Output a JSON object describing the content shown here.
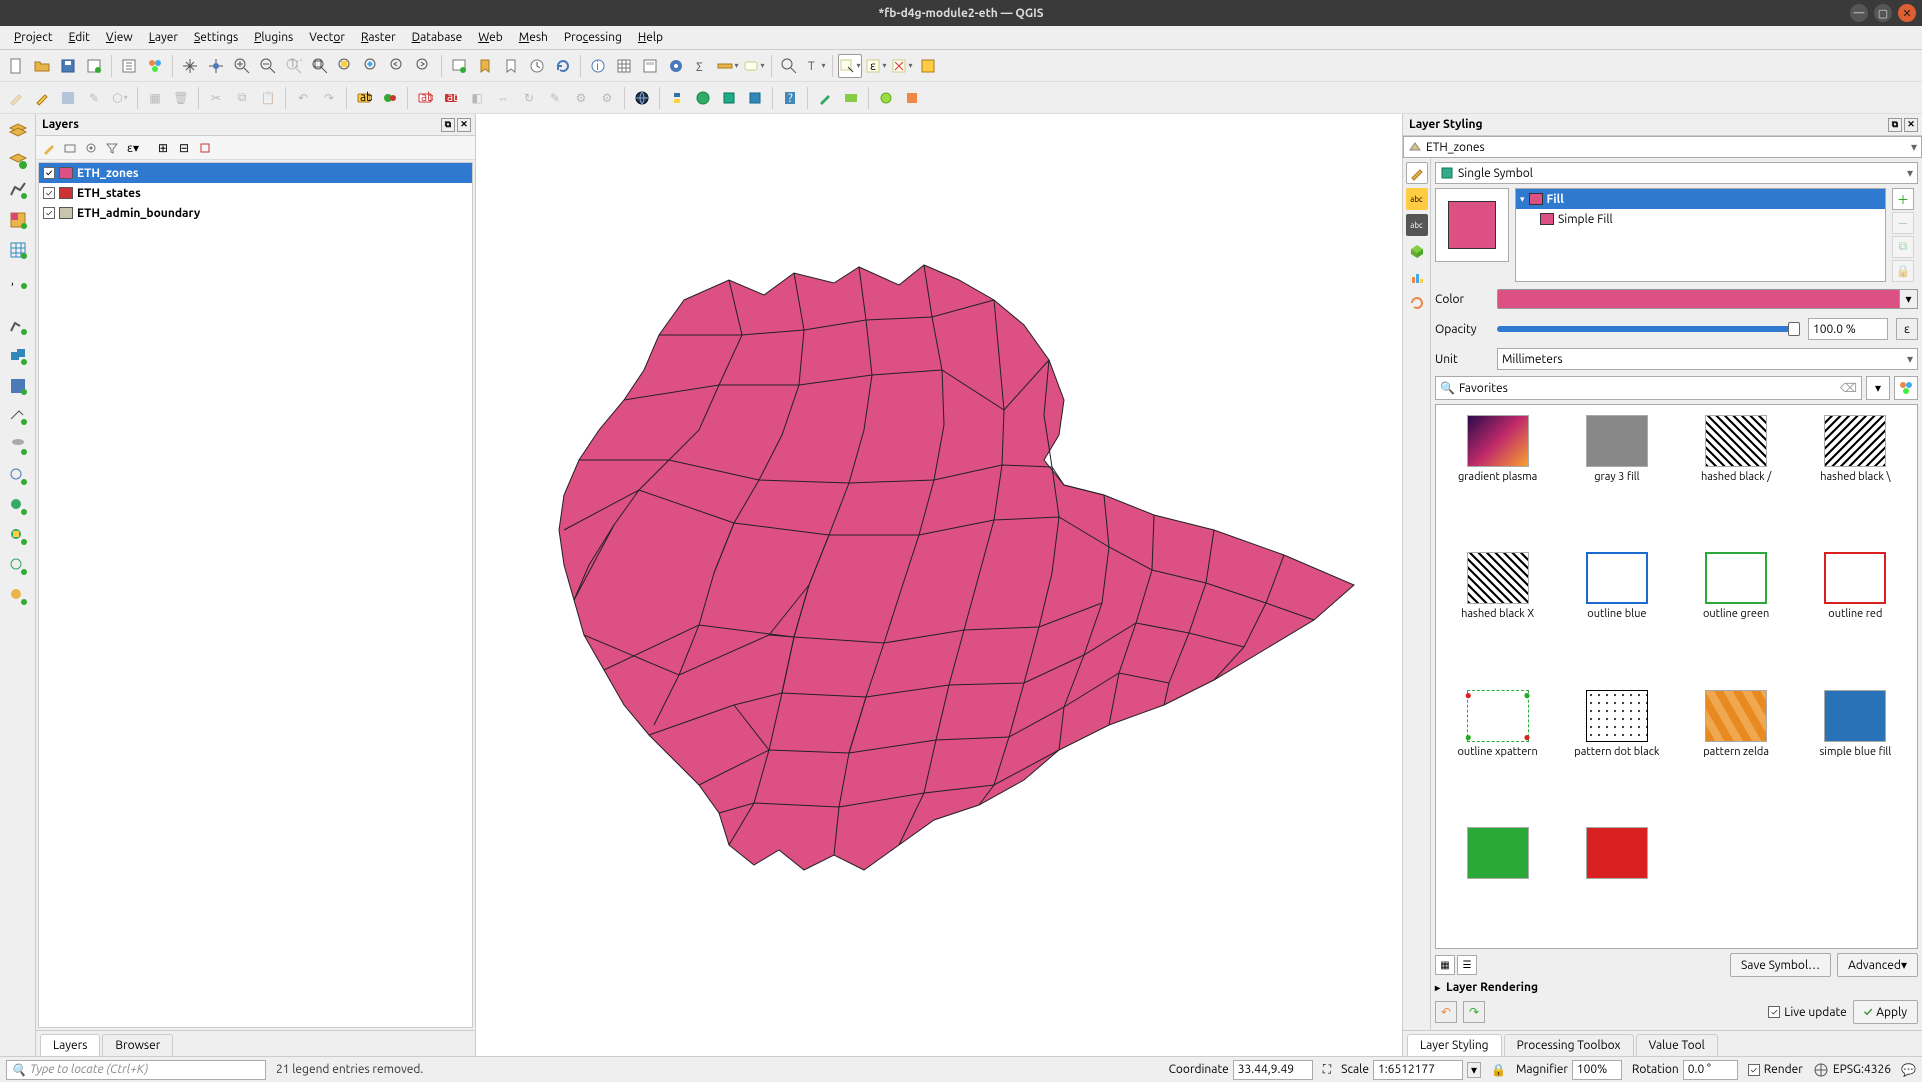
{
  "window": {
    "title": "*fb-d4g-module2-eth — QGIS"
  },
  "menubar": [
    "Project",
    "Edit",
    "View",
    "Layer",
    "Settings",
    "Plugins",
    "Vector",
    "Raster",
    "Database",
    "Web",
    "Mesh",
    "Processing",
    "Help"
  ],
  "layers_panel": {
    "title": "Layers",
    "items": [
      {
        "name": "ETH_zones",
        "checked": true,
        "color": "#dc5083",
        "selected": true
      },
      {
        "name": "ETH_states",
        "checked": true,
        "color": "#cc3333",
        "selected": false
      },
      {
        "name": "ETH_admin_boundary",
        "checked": true,
        "color": "#c9c4ad",
        "selected": false
      }
    ],
    "tabs": [
      "Layers",
      "Browser"
    ],
    "active_tab": "Layers"
  },
  "styling": {
    "title": "Layer Styling",
    "layer_select": "ETH_zones",
    "renderer": "Single Symbol",
    "fill_tree": {
      "root": "Fill",
      "child": "Simple Fill"
    },
    "color_label": "Color",
    "color_value": "#dc5083",
    "opacity_label": "Opacity",
    "opacity_value": "100.0 %",
    "unit_label": "Unit",
    "unit_value": "Millimeters",
    "search_value": "Favorites",
    "symbols": [
      "gradient plasma",
      "gray 3 fill",
      "hashed black /",
      "hashed black \\",
      "hashed black X",
      "outline blue",
      "outline green",
      "outline red",
      "outline xpattern",
      "pattern dot black",
      "pattern zelda",
      "simple blue fill",
      "",
      ""
    ],
    "save_symbol": "Save Symbol…",
    "advanced": "Advanced",
    "layer_rendering": "Layer Rendering",
    "live_update": "Live update",
    "apply": "Apply",
    "tabs": [
      "Layer Styling",
      "Processing Toolbox",
      "Value Tool"
    ],
    "active_tab": "Layer Styling"
  },
  "statusbar": {
    "placeholder": "Type to locate (Ctrl+K)",
    "message": "21 legend entries removed.",
    "coord_label": "Coordinate",
    "coord_value": "33.44,9.49",
    "scale_label": "Scale",
    "scale_value": "1:6512177",
    "magnifier_label": "Magnifier",
    "magnifier_value": "100%",
    "rotation_label": "Rotation",
    "rotation_value": "0.0 °",
    "render_label": "Render",
    "crs_value": "EPSG:4326"
  }
}
